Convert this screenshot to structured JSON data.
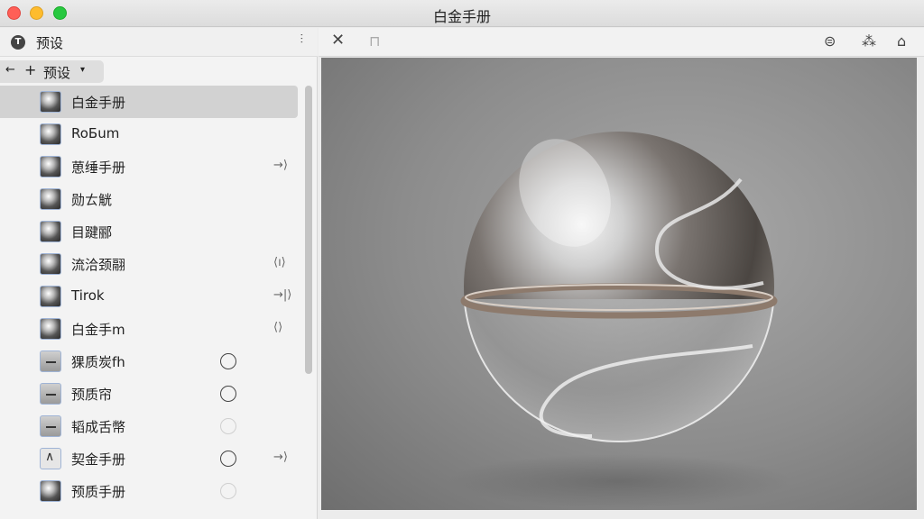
{
  "window": {
    "title": "白金手册"
  },
  "sidebar": {
    "header_title": "预设",
    "breadcrumb": {
      "label": "预设"
    },
    "items": [
      {
        "label": "白金手册",
        "thumb": "sphere",
        "selected": true,
        "radio": "",
        "action": ""
      },
      {
        "label": "RoБum",
        "thumb": "sphere",
        "selected": false,
        "radio": "",
        "action": ""
      },
      {
        "label": "葸缍手册",
        "thumb": "sphere",
        "selected": false,
        "radio": "",
        "action": "→⟩"
      },
      {
        "label": "勋ㄊ觥",
        "thumb": "sphere",
        "selected": false,
        "radio": "",
        "action": ""
      },
      {
        "label": "目踺郦",
        "thumb": "sphere",
        "selected": false,
        "radio": "",
        "action": ""
      },
      {
        "label": "流洽颈翮",
        "thumb": "sphere",
        "selected": false,
        "radio": "",
        "action": "⟨ı⟩"
      },
      {
        "label": "Tirok",
        "thumb": "sphere",
        "selected": false,
        "radio": "",
        "action": "→|⟩"
      },
      {
        "label": "白金手m",
        "thumb": "sphere",
        "selected": false,
        "radio": "",
        "action": "⟨⟩"
      },
      {
        "label": "猓质炭fh",
        "thumb": "flat",
        "selected": false,
        "radio": "solid",
        "action": ""
      },
      {
        "label": "预质帘",
        "thumb": "flat",
        "selected": false,
        "radio": "solid",
        "action": ""
      },
      {
        "label": "韬成舌幣",
        "thumb": "flat",
        "selected": false,
        "radio": "faint",
        "action": ""
      },
      {
        "label": "契金手册",
        "thumb": "tri",
        "selected": false,
        "radio": "solid",
        "action": "→⟩"
      },
      {
        "label": "预质手册",
        "thumb": "sphere",
        "selected": false,
        "radio": "faint",
        "action": ""
      }
    ]
  },
  "toolbar": {
    "close_icon": "close-icon",
    "pin_icon": "pin-icon",
    "right_icons": [
      "view-icon",
      "grid-icon",
      "bookmark-icon"
    ]
  },
  "colors": {
    "selected_row": "#d2d2d2",
    "viewer_bg": "#8c8c8c",
    "traffic_close": "#ff5f57",
    "traffic_min": "#febc2e",
    "traffic_max": "#28c840"
  }
}
